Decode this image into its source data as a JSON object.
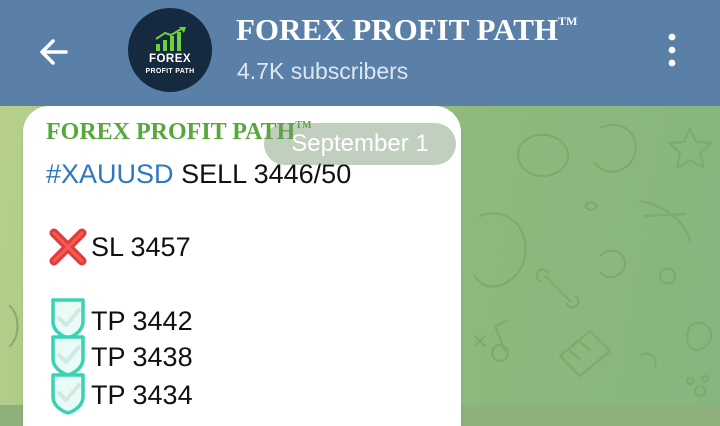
{
  "header": {
    "back_icon": "arrow-left-icon",
    "channel_name": "FOREX PROFIT PATH",
    "trademark": "TM",
    "subscribers": "4.7K subscribers",
    "menu_icon": "more-vertical-icon",
    "colors": {
      "bar": "#5a80a8",
      "title": "#ffffff",
      "subtitle": "#dde7f1"
    }
  },
  "avatar": {
    "icon": "bar-chart-up-icon",
    "line1": "FOREX",
    "line2": "PROFIT PATH",
    "colors": {
      "background": "#15293f",
      "bars": "#6fcf3c"
    }
  },
  "date_pill": {
    "label": "September 1"
  },
  "message": {
    "title": "FOREX PROFIT PATH",
    "trademark": "TM",
    "hashtag": "#XAUUSD",
    "signal": "SELL 3446/50",
    "stop_loss": {
      "icon": "cross-mark-icon",
      "label": "SL 3457"
    },
    "targets": [
      {
        "icon": "check-shield-icon",
        "label": "TP 3442"
      },
      {
        "icon": "check-shield-icon",
        "label": "TP 3438"
      },
      {
        "icon": "check-shield-icon",
        "label": "TP 3434"
      }
    ],
    "colors": {
      "title": "#57a83a",
      "hashtag": "#2f77bf",
      "stop_icon": "#e23b3b",
      "target_icon": "#39d3b4"
    }
  }
}
